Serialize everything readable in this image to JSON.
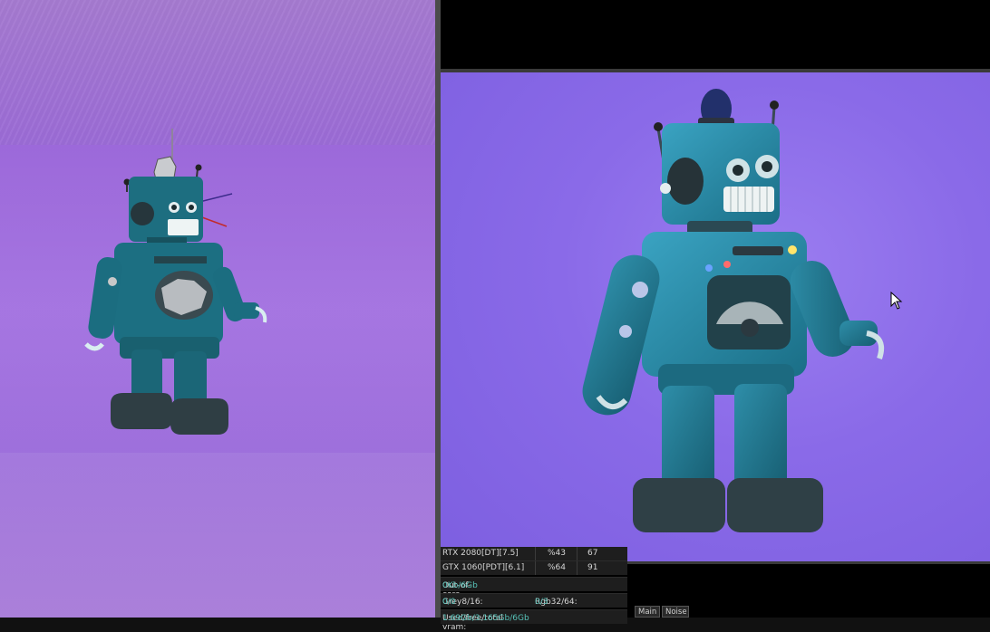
{
  "stats": {
    "gpus": [
      {
        "name": "RTX 2080[DT][7.5]",
        "usage": "%43",
        "temp": "67"
      },
      {
        "name": "GTX 1060[PDT][6.1]",
        "usage": "%64",
        "temp": "91"
      }
    ],
    "out_of_core_label": "Out-of-core used/max:",
    "out_of_core_value": "0Kb/6Gb",
    "grey_label": "Grey8/16: ",
    "grey_value": "0/0",
    "rgb_label": "Rgb32/64: ",
    "rgb_value": "0/3",
    "vram_label": "Used/free/total vram: ",
    "vram_value": "1.69Gb/3.165Gb/6Gb"
  },
  "buttons": {
    "main": "Main",
    "noise": "Noise"
  },
  "colors": {
    "background_purple": "#9b6fd8",
    "robot_teal": "#1f7f96",
    "stat_value": "#57c3b9"
  }
}
